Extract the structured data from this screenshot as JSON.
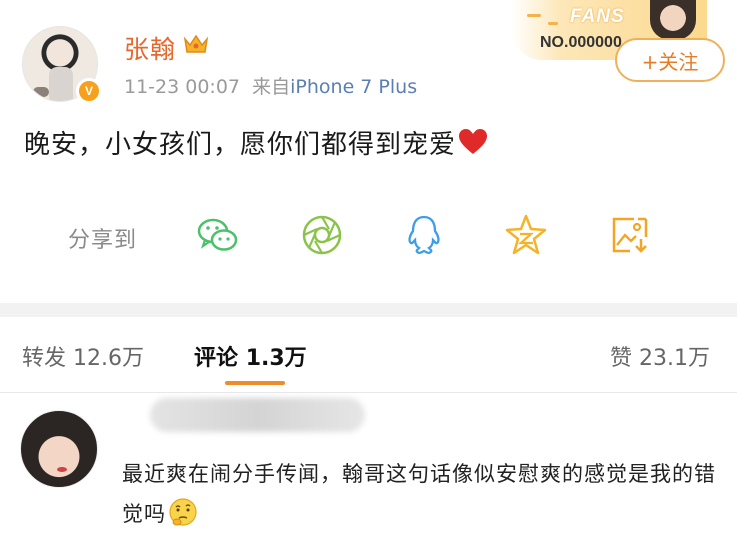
{
  "post": {
    "username": "张翰",
    "time": "11-23 00:07",
    "source_prefix": "来自",
    "source": "iPhone 7 Plus",
    "content": "晚安，小女孩们，愿你们都得到宠爱",
    "avatar_badge": "V"
  },
  "fans_banner": {
    "label": "FANS",
    "number": "NO.000000"
  },
  "follow_button": {
    "label": "+关注"
  },
  "share": {
    "label": "分享到",
    "icons": [
      "wechat-icon",
      "moments-icon",
      "qq-icon",
      "qzone-icon",
      "save-image-icon"
    ]
  },
  "tabs": {
    "repost": {
      "label": "转发",
      "count": "12.6万"
    },
    "comments": {
      "label": "评论",
      "count": "1.3万"
    },
    "likes": {
      "label": "赞",
      "count": "23.1万"
    }
  },
  "comment": {
    "text": "最近爽在闹分手传闻，翰哥这句话像似安慰爽的感觉是我的错觉吗"
  },
  "colors": {
    "username": "#e8672b",
    "accent": "#f08c27",
    "share_icon": "#4cc06a",
    "qq_icon": "#3d9ee8",
    "zone_icon": "#f4b32a"
  }
}
